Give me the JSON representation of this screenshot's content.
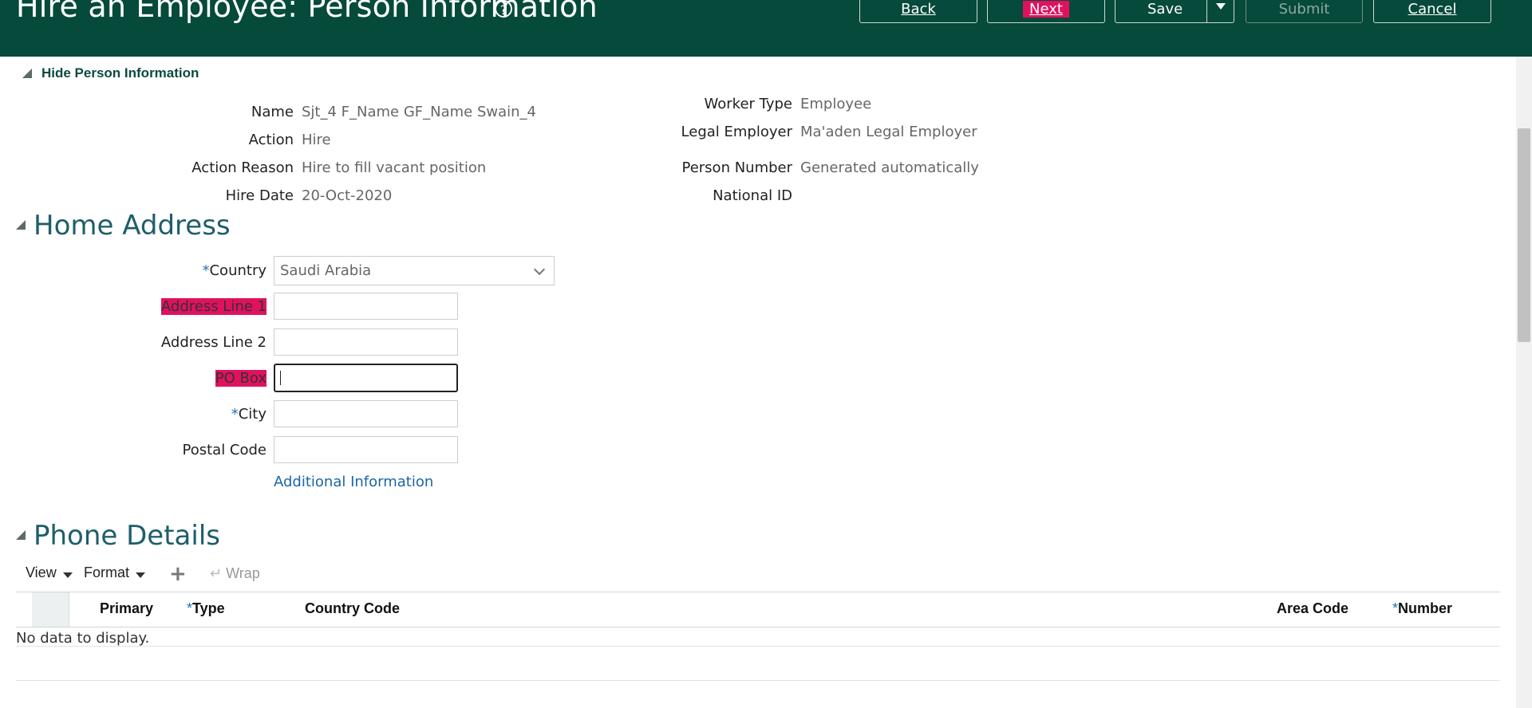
{
  "header": {
    "title": "Hire an Employee: Person Information",
    "help_icon": "help-circle-icon",
    "buttons": {
      "back": "Back",
      "next": "Next",
      "save": "Save",
      "submit": "Submit",
      "cancel": "Cancel"
    }
  },
  "person_info": {
    "toggle_label": "Hide Person Information",
    "left": {
      "name_label": "Name",
      "name_value": "Sjt_4 F_Name GF_Name Swain_4",
      "action_label": "Action",
      "action_value": "Hire",
      "reason_label": "Action Reason",
      "reason_value": "Hire to fill vacant position",
      "hire_date_label": "Hire Date",
      "hire_date_value": "20-Oct-2020"
    },
    "right": {
      "worker_type_label": "Worker Type",
      "worker_type_value": "Employee",
      "legal_employer_label": "Legal Employer",
      "legal_employer_value": "Ma'aden Legal Employer",
      "person_number_label": "Person Number",
      "person_number_value": "Generated automatically",
      "national_id_label": "National ID"
    }
  },
  "home_address": {
    "title": "Home Address",
    "country_label": "Country",
    "country_value": "Saudi Arabia",
    "address1_label": "Address Line 1",
    "address2_label": "Address Line 2",
    "po_box_label": "PO Box",
    "city_label": "City",
    "postal_code_label": "Postal Code",
    "additional_info_link": "Additional Information",
    "required_mark": "*"
  },
  "phone_details": {
    "title": "Phone Details",
    "toolbar": {
      "view": "View",
      "format": "Format",
      "add_icon": "plus-icon",
      "wrap": "Wrap",
      "wrap_icon": "wrap-icon"
    },
    "columns": {
      "primary": "Primary",
      "type": "Type",
      "country_code": "Country Code",
      "area_code": "Area Code",
      "number": "Number"
    },
    "empty_message": "No data to display."
  },
  "colors": {
    "header_bg": "#054a3b",
    "highlight": "#e0115f",
    "link": "#1a66a8",
    "section_title": "#1e5e6b"
  }
}
